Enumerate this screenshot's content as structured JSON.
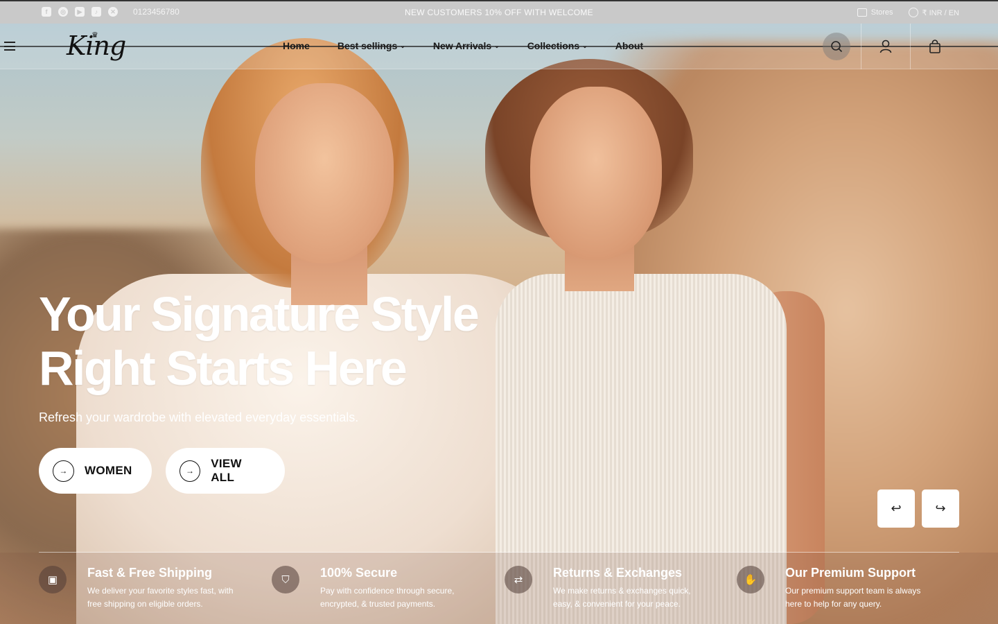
{
  "topbar": {
    "socials": [
      "facebook-icon",
      "instagram-icon",
      "youtube-icon",
      "tiktok-icon",
      "x-icon"
    ],
    "phone": "0123456780",
    "promo": "NEW CUSTOMERS 10% OFF WITH WELCOME",
    "stores_label": "Stores",
    "currency_lang": "₹ INR / EN"
  },
  "header": {
    "logo": "King",
    "nav": [
      {
        "label": "Home",
        "has_dropdown": false
      },
      {
        "label": "Best sellings",
        "has_dropdown": true
      },
      {
        "label": "New Arrivals",
        "has_dropdown": true
      },
      {
        "label": "Collections",
        "has_dropdown": true
      },
      {
        "label": "About",
        "has_dropdown": false
      }
    ],
    "icons": [
      "search-icon",
      "user-icon",
      "bag-icon"
    ]
  },
  "hero": {
    "headline_line1": "Your Signature Style",
    "headline_line2": "Right Starts Here",
    "subtext": "Refresh your wardrobe with elevated everyday essentials.",
    "cta_women": "WOMEN",
    "cta_view_all": "VIEW ALL",
    "prev_glyph": "↩",
    "next_glyph": "↪"
  },
  "features": [
    {
      "icon": "box-icon",
      "title": "Fast & Free Shipping",
      "desc": "We deliver your favorite styles fast, with free shipping on eligible orders."
    },
    {
      "icon": "shield-icon",
      "title": "100% Secure",
      "desc": "Pay with confidence through secure, encrypted, & trusted payments."
    },
    {
      "icon": "return-icon",
      "title": "Returns & Exchanges",
      "desc": "We make returns & exchanges quick, easy, & convenient for your peace."
    },
    {
      "icon": "support-icon",
      "title": "Our Premium Support",
      "desc": "Our premium support team is always here to help for any query."
    }
  ],
  "colors": {
    "topbar_bg": "#c9c9c9",
    "text_light": "#ffffff",
    "text_dark": "#111111"
  }
}
